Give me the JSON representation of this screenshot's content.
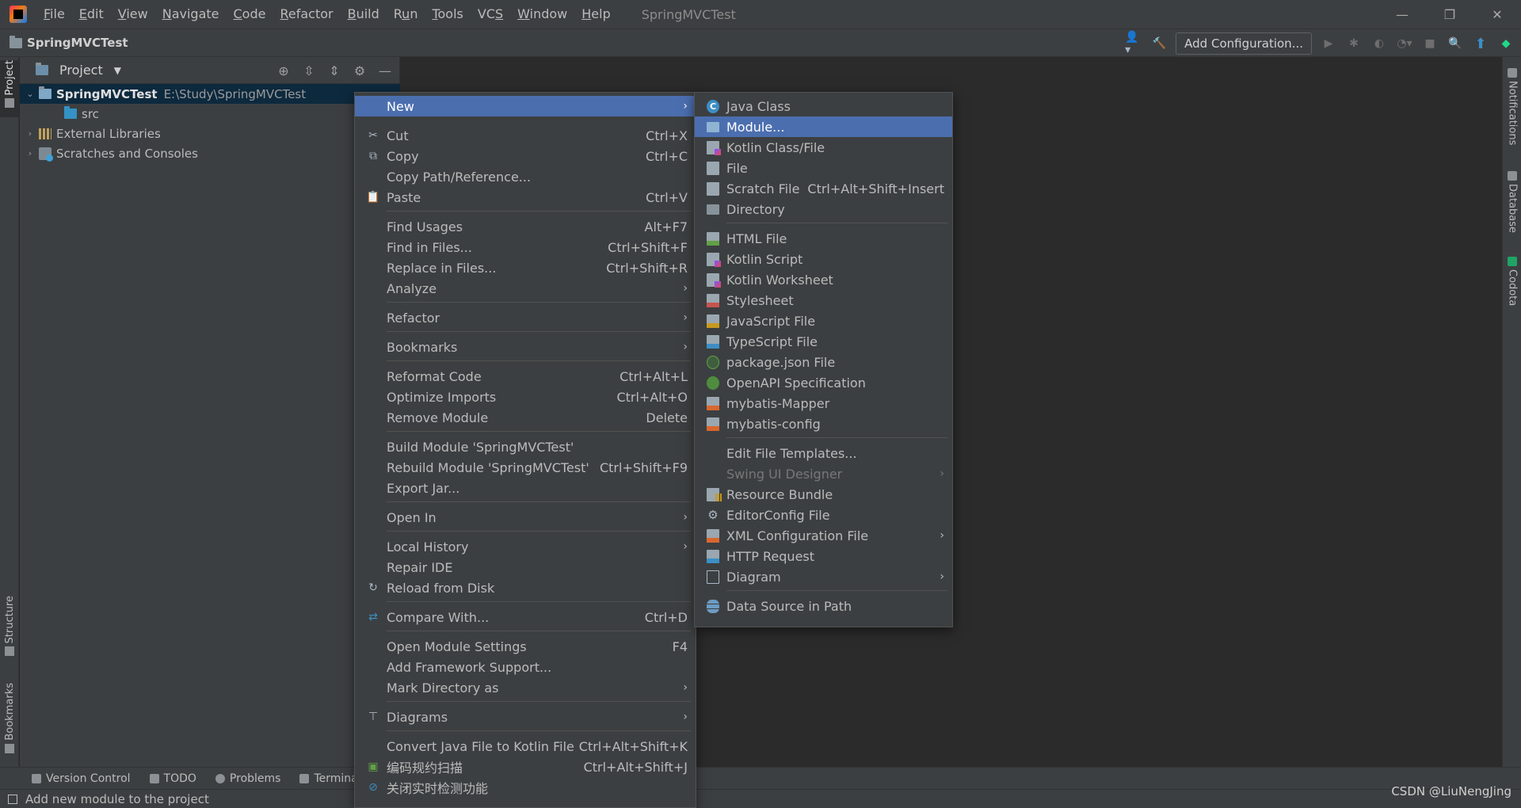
{
  "menubar": {
    "items": [
      {
        "pre": "",
        "mn": "F",
        "post": "ile"
      },
      {
        "pre": "",
        "mn": "E",
        "post": "dit"
      },
      {
        "pre": "",
        "mn": "V",
        "post": "iew"
      },
      {
        "pre": "",
        "mn": "N",
        "post": "avigate"
      },
      {
        "pre": "",
        "mn": "C",
        "post": "ode"
      },
      {
        "pre": "",
        "mn": "R",
        "post": "efactor"
      },
      {
        "pre": "",
        "mn": "B",
        "post": "uild"
      },
      {
        "pre": "R",
        "mn": "u",
        "post": "n"
      },
      {
        "pre": "",
        "mn": "T",
        "post": "ools"
      },
      {
        "pre": "VC",
        "mn": "S",
        "post": ""
      },
      {
        "pre": "",
        "mn": "W",
        "post": "indow"
      },
      {
        "pre": "",
        "mn": "H",
        "post": "elp"
      }
    ],
    "window_title": "SpringMVCTest",
    "controls": [
      "—",
      "❐",
      "✕"
    ]
  },
  "navbar": {
    "breadcrumb": "SpringMVCTest",
    "add_configuration": "Add Configuration..."
  },
  "left_strip": {
    "project": "Project",
    "structure": "Structure",
    "bookmarks": "Bookmarks"
  },
  "right_strip": {
    "notifications": "Notifications",
    "database": "Database",
    "codota": "Codota"
  },
  "project_panel": {
    "title": "Project",
    "tree": [
      {
        "label": "SpringMVCTest",
        "path": "E:\\Study\\SpringMVCTest"
      },
      {
        "label": "src"
      },
      {
        "label": "External Libraries"
      },
      {
        "label": "Scratches and Consoles"
      }
    ]
  },
  "context_menu": {
    "items": [
      {
        "label": "New",
        "shortcut": "",
        "icon": "",
        "submenu": true
      },
      {
        "label": "Cut",
        "shortcut": "Ctrl+X",
        "icon": "✂"
      },
      {
        "label": "Copy",
        "shortcut": "Ctrl+C",
        "icon": "⧉"
      },
      {
        "label": "Copy Path/Reference...",
        "shortcut": ""
      },
      {
        "label": "Paste",
        "shortcut": "Ctrl+V",
        "icon": "📋"
      },
      {
        "label": "Find Usages",
        "shortcut": "Alt+F7"
      },
      {
        "label": "Find in Files...",
        "shortcut": "Ctrl+Shift+F"
      },
      {
        "label": "Replace in Files...",
        "shortcut": "Ctrl+Shift+R"
      },
      {
        "label": "Analyze",
        "shortcut": "",
        "submenu": true
      },
      {
        "label": "Refactor",
        "shortcut": "",
        "submenu": true
      },
      {
        "label": "Bookmarks",
        "shortcut": "",
        "submenu": true
      },
      {
        "label": "Reformat Code",
        "shortcut": "Ctrl+Alt+L"
      },
      {
        "label": "Optimize Imports",
        "shortcut": "Ctrl+Alt+O"
      },
      {
        "label": "Remove Module",
        "shortcut": "Delete"
      },
      {
        "label": "Build Module 'SpringMVCTest'",
        "shortcut": ""
      },
      {
        "label": "Rebuild Module 'SpringMVCTest'",
        "shortcut": "Ctrl+Shift+F9"
      },
      {
        "label": "Export Jar...",
        "shortcut": ""
      },
      {
        "label": "Open In",
        "shortcut": "",
        "submenu": true
      },
      {
        "label": "Local History",
        "shortcut": "",
        "submenu": true
      },
      {
        "label": "Repair IDE",
        "shortcut": ""
      },
      {
        "label": "Reload from Disk",
        "shortcut": "",
        "icon": "↻"
      },
      {
        "label": "Compare With...",
        "shortcut": "Ctrl+D",
        "icon": "⇄"
      },
      {
        "label": "Open Module Settings",
        "shortcut": "F4"
      },
      {
        "label": "Add Framework Support...",
        "shortcut": ""
      },
      {
        "label": "Mark Directory as",
        "shortcut": "",
        "submenu": true
      },
      {
        "label": "Diagrams",
        "shortcut": "",
        "submenu": true
      },
      {
        "label": "Convert Java File to Kotlin File",
        "shortcut": "Ctrl+Alt+Shift+K"
      },
      {
        "label": "编码规约扫描",
        "shortcut": "Ctrl+Alt+Shift+J"
      },
      {
        "label": "关闭实时检测功能",
        "shortcut": ""
      }
    ]
  },
  "new_submenu": {
    "items": [
      {
        "label": "Java Class",
        "shortcut": ""
      },
      {
        "label": "Module...",
        "shortcut": ""
      },
      {
        "label": "Kotlin Class/File",
        "shortcut": ""
      },
      {
        "label": "File",
        "shortcut": ""
      },
      {
        "label": "Scratch File",
        "shortcut": "Ctrl+Alt+Shift+Insert"
      },
      {
        "label": "Directory",
        "shortcut": ""
      },
      {
        "label": "HTML File",
        "shortcut": ""
      },
      {
        "label": "Kotlin Script",
        "shortcut": ""
      },
      {
        "label": "Kotlin Worksheet",
        "shortcut": ""
      },
      {
        "label": "Stylesheet",
        "shortcut": ""
      },
      {
        "label": "JavaScript File",
        "shortcut": ""
      },
      {
        "label": "TypeScript File",
        "shortcut": ""
      },
      {
        "label": "package.json File",
        "shortcut": ""
      },
      {
        "label": "OpenAPI Specification",
        "shortcut": ""
      },
      {
        "label": "mybatis-Mapper",
        "shortcut": ""
      },
      {
        "label": "mybatis-config",
        "shortcut": ""
      },
      {
        "label": "Edit File Templates...",
        "shortcut": ""
      },
      {
        "label": "Swing UI Designer",
        "shortcut": ""
      },
      {
        "label": "Resource Bundle",
        "shortcut": ""
      },
      {
        "label": "EditorConfig File",
        "shortcut": ""
      },
      {
        "label": "XML Configuration File",
        "shortcut": ""
      },
      {
        "label": "HTTP Request",
        "shortcut": ""
      },
      {
        "label": "Diagram",
        "shortcut": ""
      },
      {
        "label": "Data Source in Path",
        "shortcut": ""
      }
    ],
    "icon_labels": {
      "java": "C",
      "css": "CSS",
      "js": "JS",
      "ts": "TS",
      "xml": "<?>",
      "api": "API"
    }
  },
  "bottom_tabs": [
    "Version Control",
    "TODO",
    "Problems",
    "Terminal"
  ],
  "status": {
    "message": "Add new module to the project"
  },
  "watermark": "CSDN @LiuNengJing",
  "colors": {
    "highlight": "#4b6eaf",
    "background": "#2b2b2b",
    "panel": "#3c3f41"
  }
}
